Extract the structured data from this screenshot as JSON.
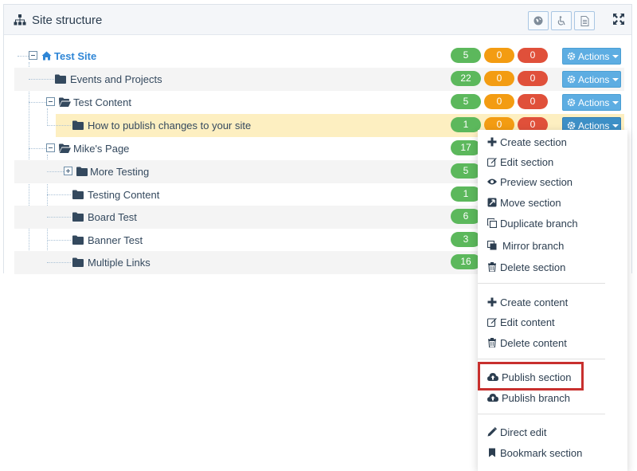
{
  "panel": {
    "title": "Site structure",
    "icons": [
      "sitemap-icon",
      "globe-icon",
      "wheelchair-icon",
      "document-icon",
      "expand-icon"
    ]
  },
  "rows": [
    {
      "label": "Test Site",
      "green": "5",
      "orange": "0",
      "red": "0",
      "actions": "Actions"
    },
    {
      "label": "Events and Projects",
      "green": "22",
      "orange": "0",
      "red": "0",
      "actions": "Actions"
    },
    {
      "label": "Test Content",
      "green": "5",
      "orange": "0",
      "red": "0",
      "actions": "Actions"
    },
    {
      "label": "How to publish changes to your site",
      "green": "1",
      "orange": "0",
      "red": "0",
      "actions": "Actions"
    },
    {
      "label": "Mike's Page",
      "green": "17"
    },
    {
      "label": "More Testing",
      "green": "5"
    },
    {
      "label": "Testing Content",
      "green": "1"
    },
    {
      "label": "Board Test",
      "green": "6"
    },
    {
      "label": "Banner Test",
      "green": "3"
    },
    {
      "label": "Multiple Links",
      "green": "16"
    }
  ],
  "menu": {
    "create_section": "Create section",
    "edit_section": "Edit section",
    "preview_section": "Preview section",
    "move_section": "Move section",
    "duplicate_branch": "Duplicate branch",
    "mirror_branch": "Mirror branch",
    "delete_section": "Delete section",
    "create_content": "Create content",
    "edit_content": "Edit content",
    "delete_content": "Delete content",
    "publish_section": "Publish section",
    "publish_branch": "Publish branch",
    "direct_edit": "Direct edit",
    "bookmark_section": "Bookmark section"
  },
  "colors": {
    "green_badge": "#5cb85c",
    "orange_badge": "#f39c12",
    "red_badge": "#e0503a",
    "actions_button": "#5dade2",
    "selected_row": "#fdefc1",
    "highlight": "#c8302e"
  }
}
